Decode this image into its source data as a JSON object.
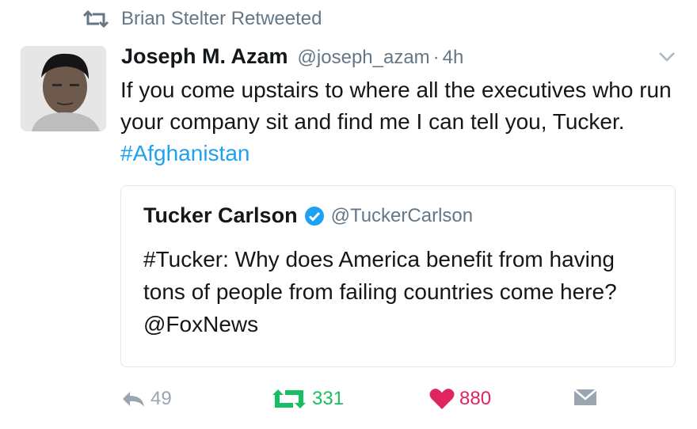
{
  "retweet_banner": {
    "text": "Brian Stelter Retweeted",
    "icon": "retweet-icon"
  },
  "tweet": {
    "author_name": "Joseph M. Azam",
    "author_handle": "@joseph_azam",
    "separator": "·",
    "time": "4h",
    "text_main": "If you come upstairs to where all the executives who run your company sit and find me I can tell you, Tucker. ",
    "hashtag": "#Afghanistan"
  },
  "quoted_tweet": {
    "author_name": "Tucker Carlson",
    "author_handle": "@TuckerCarlson",
    "verified": true,
    "text": "#Tucker: Why does America benefit from having tons of people from failing countries come here?  @FoxNews"
  },
  "actions": {
    "reply_count": "49",
    "retweet_count": "331",
    "like_count": "880"
  },
  "colors": {
    "accent": "#1da1f2",
    "retweet_green": "#17bf63",
    "like_red": "#e0245e",
    "muted": "#657786"
  }
}
